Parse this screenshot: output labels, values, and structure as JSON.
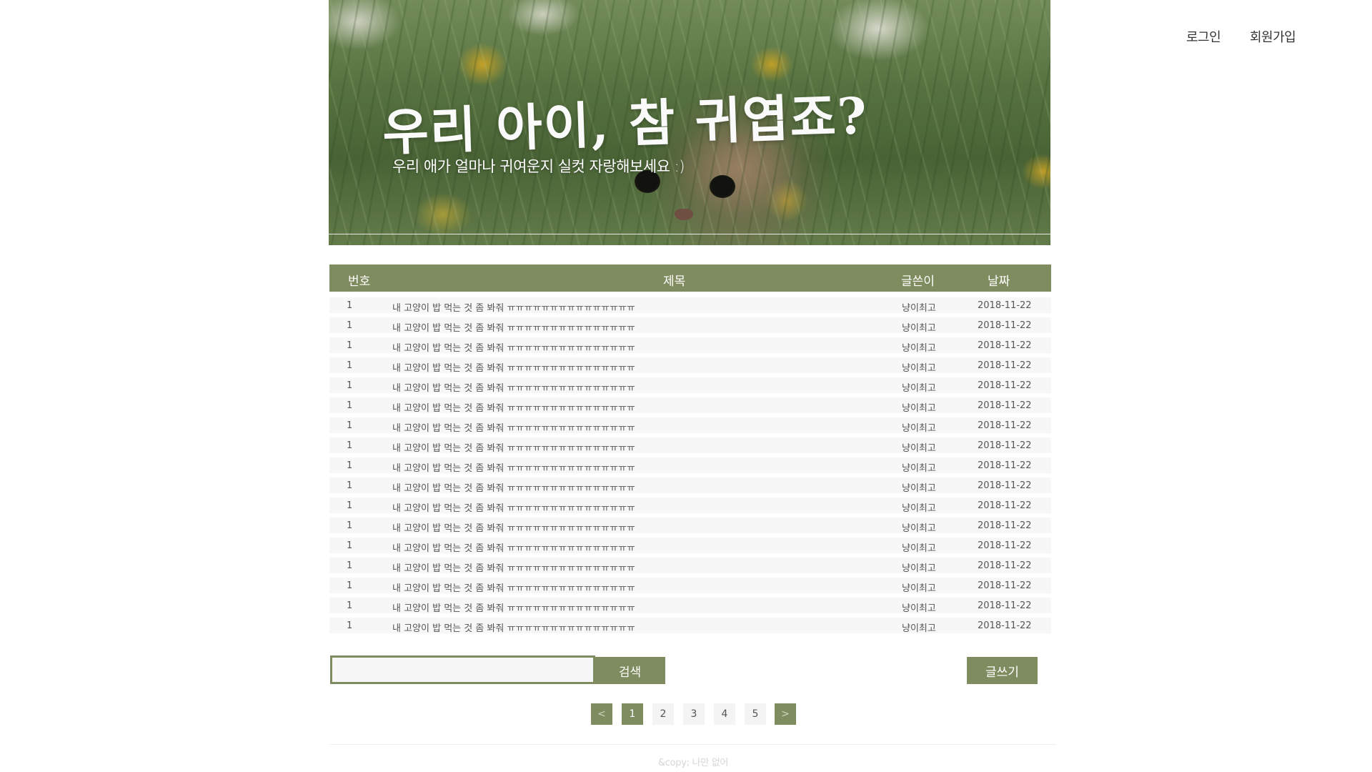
{
  "nav": {
    "login": "로그인",
    "signup": "회원가입"
  },
  "banner": {
    "title": "우리 아이, 참 귀엽죠?",
    "subtitle": "우리 애가 얼마나 귀여운지 실컷 자랑해보세요 :)"
  },
  "board": {
    "columns": {
      "number": "번호",
      "title": "제목",
      "author": "글쓴이",
      "date": "날짜"
    },
    "rows": [
      {
        "number": "1",
        "title": "내 고양이 밥 먹는 것 좀 봐줘 ㅠㅠㅠㅠㅠㅠㅠㅠㅠㅠㅠㅠㅠㅠㅠ",
        "author": "냥이최고",
        "date": "2018-11-22"
      },
      {
        "number": "1",
        "title": "내 고양이 밥 먹는 것 좀 봐줘 ㅠㅠㅠㅠㅠㅠㅠㅠㅠㅠㅠㅠㅠㅠㅠ",
        "author": "냥이최고",
        "date": "2018-11-22"
      },
      {
        "number": "1",
        "title": "내 고양이 밥 먹는 것 좀 봐줘 ㅠㅠㅠㅠㅠㅠㅠㅠㅠㅠㅠㅠㅠㅠㅠ",
        "author": "냥이최고",
        "date": "2018-11-22"
      },
      {
        "number": "1",
        "title": "내 고양이 밥 먹는 것 좀 봐줘 ㅠㅠㅠㅠㅠㅠㅠㅠㅠㅠㅠㅠㅠㅠㅠ",
        "author": "냥이최고",
        "date": "2018-11-22"
      },
      {
        "number": "1",
        "title": "내 고양이 밥 먹는 것 좀 봐줘 ㅠㅠㅠㅠㅠㅠㅠㅠㅠㅠㅠㅠㅠㅠㅠ",
        "author": "냥이최고",
        "date": "2018-11-22"
      },
      {
        "number": "1",
        "title": "내 고양이 밥 먹는 것 좀 봐줘 ㅠㅠㅠㅠㅠㅠㅠㅠㅠㅠㅠㅠㅠㅠㅠ",
        "author": "냥이최고",
        "date": "2018-11-22"
      },
      {
        "number": "1",
        "title": "내 고양이 밥 먹는 것 좀 봐줘 ㅠㅠㅠㅠㅠㅠㅠㅠㅠㅠㅠㅠㅠㅠㅠ",
        "author": "냥이최고",
        "date": "2018-11-22"
      },
      {
        "number": "1",
        "title": "내 고양이 밥 먹는 것 좀 봐줘 ㅠㅠㅠㅠㅠㅠㅠㅠㅠㅠㅠㅠㅠㅠㅠ",
        "author": "냥이최고",
        "date": "2018-11-22"
      },
      {
        "number": "1",
        "title": "내 고양이 밥 먹는 것 좀 봐줘 ㅠㅠㅠㅠㅠㅠㅠㅠㅠㅠㅠㅠㅠㅠㅠ",
        "author": "냥이최고",
        "date": "2018-11-22"
      },
      {
        "number": "1",
        "title": "내 고양이 밥 먹는 것 좀 봐줘 ㅠㅠㅠㅠㅠㅠㅠㅠㅠㅠㅠㅠㅠㅠㅠ",
        "author": "냥이최고",
        "date": "2018-11-22"
      },
      {
        "number": "1",
        "title": "내 고양이 밥 먹는 것 좀 봐줘 ㅠㅠㅠㅠㅠㅠㅠㅠㅠㅠㅠㅠㅠㅠㅠ",
        "author": "냥이최고",
        "date": "2018-11-22"
      },
      {
        "number": "1",
        "title": "내 고양이 밥 먹는 것 좀 봐줘 ㅠㅠㅠㅠㅠㅠㅠㅠㅠㅠㅠㅠㅠㅠㅠ",
        "author": "냥이최고",
        "date": "2018-11-22"
      },
      {
        "number": "1",
        "title": "내 고양이 밥 먹는 것 좀 봐줘 ㅠㅠㅠㅠㅠㅠㅠㅠㅠㅠㅠㅠㅠㅠㅠ",
        "author": "냥이최고",
        "date": "2018-11-22"
      },
      {
        "number": "1",
        "title": "내 고양이 밥 먹는 것 좀 봐줘 ㅠㅠㅠㅠㅠㅠㅠㅠㅠㅠㅠㅠㅠㅠㅠ",
        "author": "냥이최고",
        "date": "2018-11-22"
      },
      {
        "number": "1",
        "title": "내 고양이 밥 먹는 것 좀 봐줘 ㅠㅠㅠㅠㅠㅠㅠㅠㅠㅠㅠㅠㅠㅠㅠ",
        "author": "냥이최고",
        "date": "2018-11-22"
      },
      {
        "number": "1",
        "title": "내 고양이 밥 먹는 것 좀 봐줘 ㅠㅠㅠㅠㅠㅠㅠㅠㅠㅠㅠㅠㅠㅠㅠ",
        "author": "냥이최고",
        "date": "2018-11-22"
      },
      {
        "number": "1",
        "title": "내 고양이 밥 먹는 것 좀 봐줘 ㅠㅠㅠㅠㅠㅠㅠㅠㅠㅠㅠㅠㅠㅠㅠ",
        "author": "냥이최고",
        "date": "2018-11-22"
      }
    ]
  },
  "search": {
    "value": "",
    "button_label": "검색"
  },
  "write": {
    "button_label": "글쓰기"
  },
  "pagination": {
    "prev": "<",
    "pages": [
      "1",
      "2",
      "3",
      "4",
      "5"
    ],
    "current": "1",
    "next": ">"
  },
  "footer": {
    "text": "&copy; 나만 없어"
  },
  "colors": {
    "accent": "#7f8c5f",
    "row_bg": "#f7f7f7"
  }
}
